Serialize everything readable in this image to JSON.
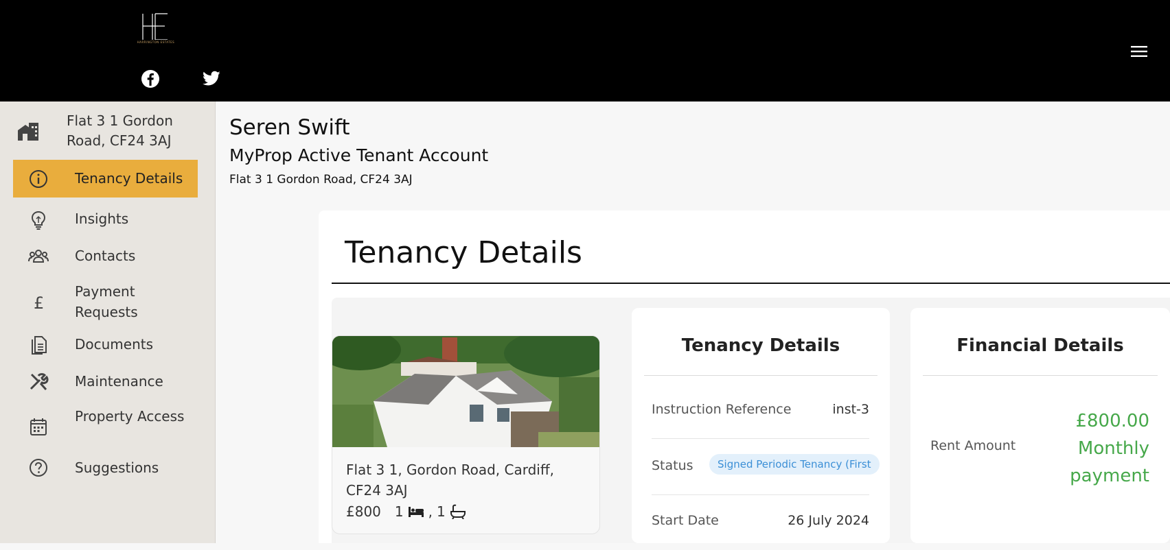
{
  "header": {
    "logo_subtext": "HARRINGTON ESTATES",
    "social": [
      "facebook-icon",
      "twitter-icon"
    ]
  },
  "sidebar": {
    "property": "Flat 3 1 Gordon Road, CF24 3AJ",
    "items": [
      {
        "label": "Tenancy Details",
        "icon": "info-icon",
        "active": true
      },
      {
        "label": "Insights",
        "icon": "lightbulb-icon"
      },
      {
        "label": "Contacts",
        "icon": "people-icon"
      },
      {
        "label": "Payment Requests",
        "icon": "pound-icon"
      },
      {
        "label": "Documents",
        "icon": "document-icon"
      },
      {
        "label": "Maintenance",
        "icon": "tools-icon"
      },
      {
        "label": "Property Access",
        "icon": "calendar-icon"
      },
      {
        "label": "Suggestions",
        "icon": "question-icon"
      }
    ],
    "accent": "#e9ad3d"
  },
  "account": {
    "name": "Seren Swift",
    "type": "MyProp Active Tenant Account",
    "address": "Flat 3 1 Gordon Road, CF24 3AJ"
  },
  "main": {
    "title": "Tenancy Details",
    "property_card": {
      "address": "Flat 3 1, Gordon Road, Cardiff, CF24 3AJ",
      "price": "£800",
      "beds": "1",
      "baths": "1"
    },
    "tenancy": {
      "title": "Tenancy Details",
      "instruction_label": "Instruction Reference",
      "instruction_value": "inst-3",
      "status_label": "Status",
      "status_value": "Signed Periodic Tenancy (First",
      "start_label": "Start Date",
      "start_value": "26 July 2024"
    },
    "financial": {
      "title": "Financial Details",
      "rent_label": "Rent Amount",
      "rent_value": "£800.00 Monthly payment",
      "rent_color": "#46a84a"
    }
  }
}
